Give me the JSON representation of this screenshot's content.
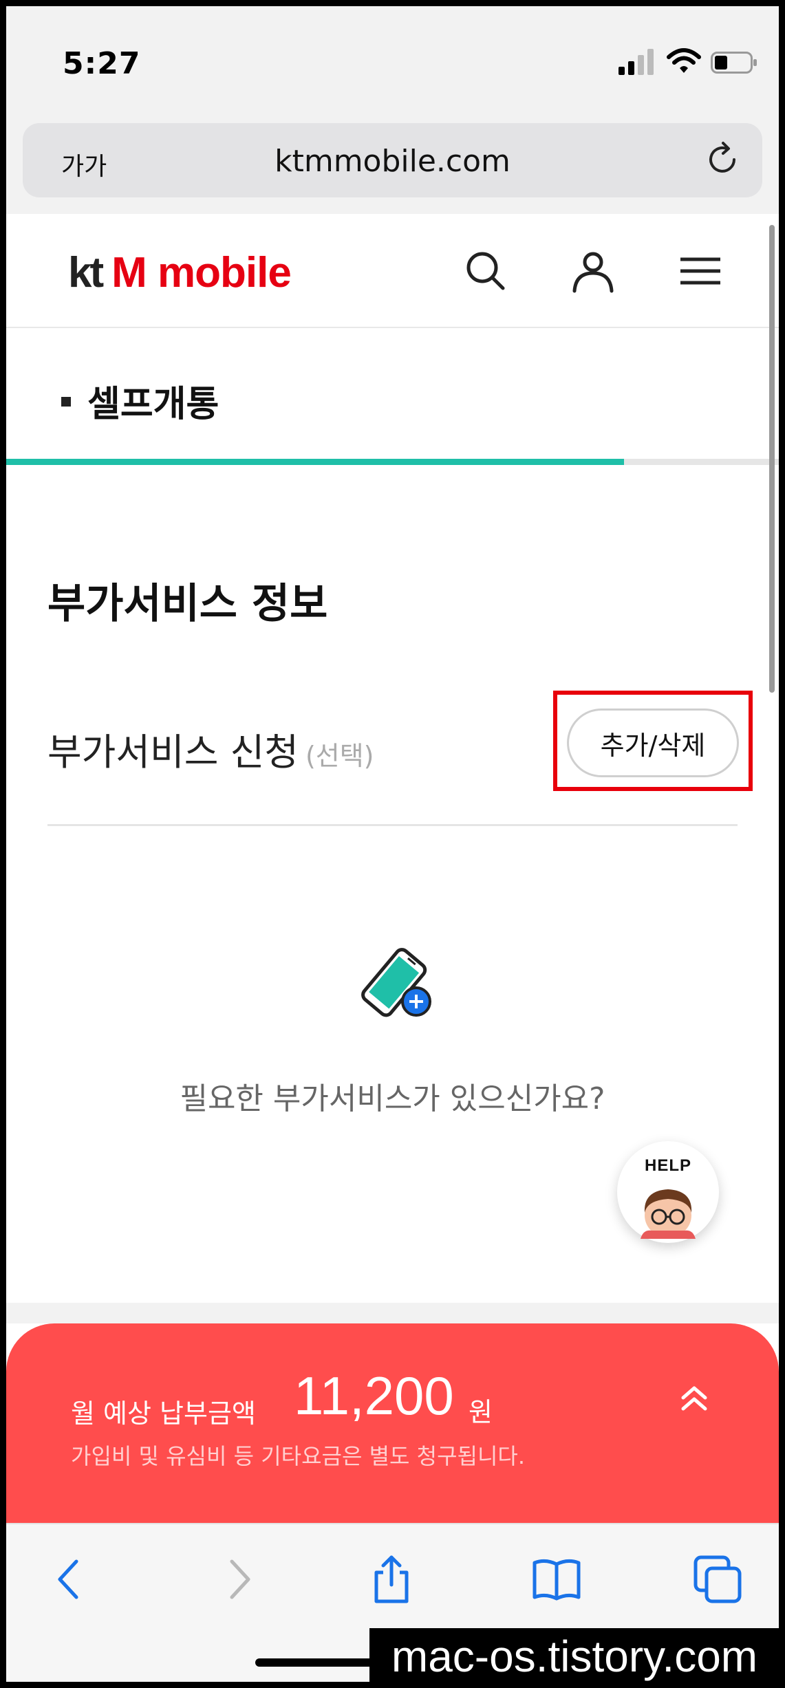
{
  "status": {
    "time": "5:27"
  },
  "browser": {
    "text_size": "가가",
    "url": "ktmmobile.com"
  },
  "header": {
    "logo_kt": "kt",
    "logo_text": "M mobile"
  },
  "page": {
    "step_title": "셀프개통",
    "progress": 0.8,
    "section_heading": "부가서비스 정보",
    "addon_label": "부가서비스 신청",
    "addon_optional": "(선택)",
    "addon_button": "추가/삭제",
    "empty_prompt": "필요한 부가서비스가 있으신가요?"
  },
  "help": {
    "label": "HELP"
  },
  "price": {
    "label": "월 예상 납부금액",
    "amount": "11,200",
    "unit": "원",
    "note": "가입비 및 유심비 등 기타요금은 별도 청구됩니다."
  },
  "watermark": "mac-os.tistory.com",
  "colors": {
    "brand_red": "#e60012",
    "progress": "#1fbfa8",
    "price_panel": "#ff4d4d",
    "ios_blue": "#1a73e8"
  }
}
